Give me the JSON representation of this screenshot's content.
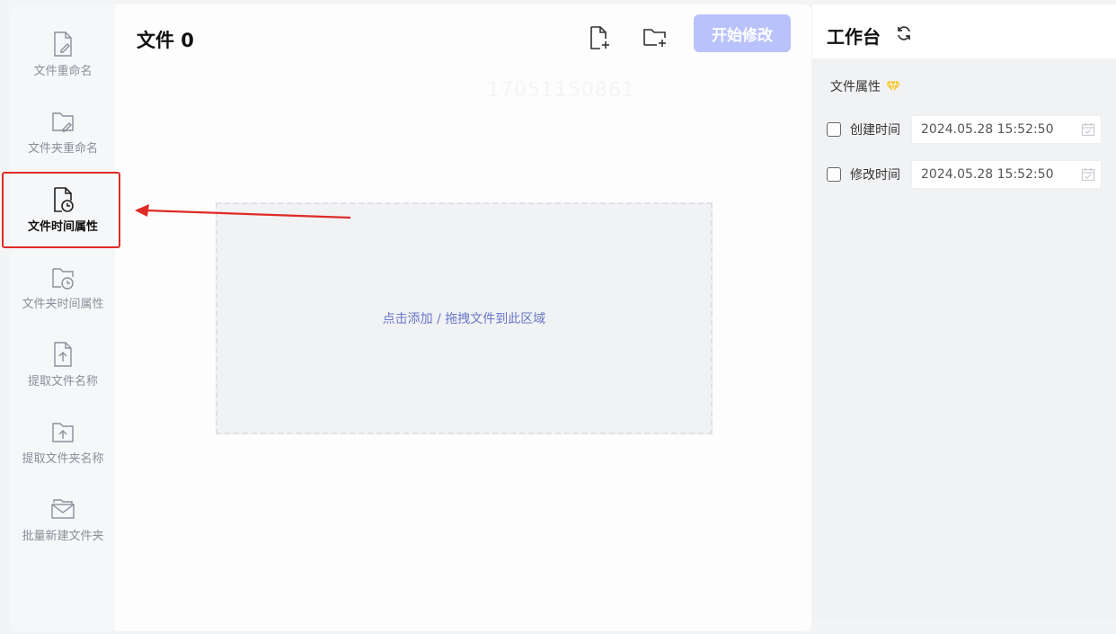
{
  "sidebar": {
    "items": [
      {
        "label": "文件重命名",
        "icon": "file-edit-icon"
      },
      {
        "label": "文件夹重命名",
        "icon": "folder-edit-icon"
      },
      {
        "label": "文件时间属性",
        "icon": "file-clock-icon",
        "active": true
      },
      {
        "label": "文件夹时间属性",
        "icon": "folder-clock-icon"
      },
      {
        "label": "提取文件名称",
        "icon": "file-upload-icon"
      },
      {
        "label": "提取文件夹名称",
        "icon": "folder-upload-icon"
      },
      {
        "label": "批量新建文件夹",
        "icon": "folder-mail-icon"
      }
    ]
  },
  "main": {
    "title": "文件 0",
    "add_file_icon": "file-add-icon",
    "add_folder_icon": "folder-add-icon",
    "start_button": "开始修改",
    "watermark": "17051150861",
    "dropzone_text": "点击添加 / 拖拽文件到此区域"
  },
  "workbench": {
    "title": "工作台",
    "refresh_icon": "refresh-icon",
    "attr_label": "文件属性",
    "premium_icon": "diamond-icon",
    "created": {
      "label": "创建时间",
      "value": "2024.05.28 15:52:50"
    },
    "modified": {
      "label": "修改时间",
      "value": "2024.05.28 15:52:50"
    }
  },
  "colors": {
    "accent": "#b9c2fa",
    "link": "#6877c9",
    "highlight": "#e02a26",
    "premium": "#f5c842"
  }
}
